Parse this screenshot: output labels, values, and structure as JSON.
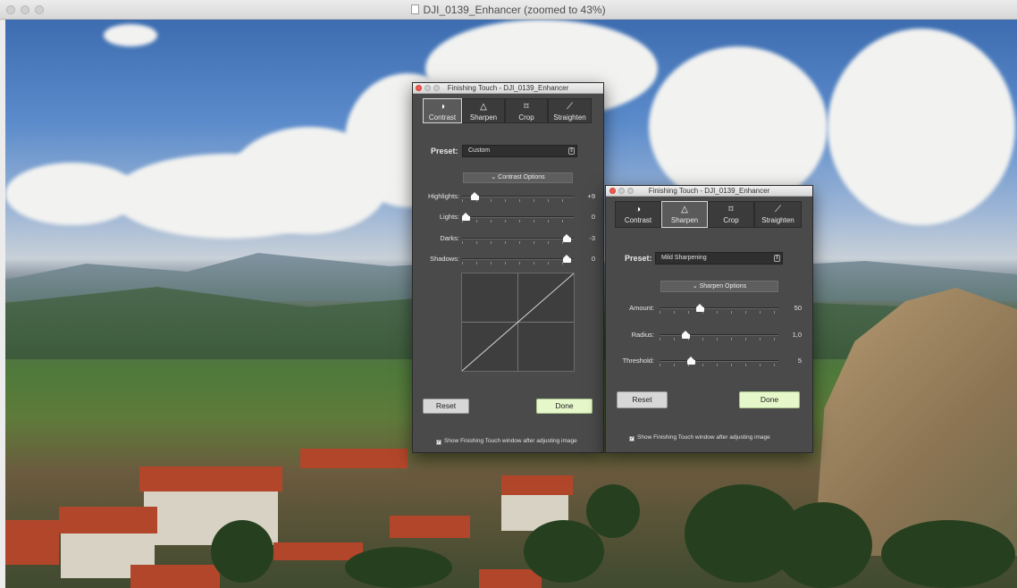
{
  "main_window": {
    "title": "DJI_0139_Enhancer (zoomed to 43%)"
  },
  "contrast_panel": {
    "title": "Finishing Touch - DJI_0139_Enhancer",
    "tools": [
      {
        "label": "Contrast",
        "icon": "◑",
        "active": true
      },
      {
        "label": "Sharpen",
        "icon": "△",
        "active": false
      },
      {
        "label": "Crop",
        "icon": "⌑",
        "active": false
      },
      {
        "label": "Straighten",
        "icon": "⟋",
        "active": false
      }
    ],
    "preset_label": "Preset:",
    "preset_value": "Custom",
    "options_label": "⌄  Contrast Options",
    "sliders": [
      {
        "label": "Highlights:",
        "value": "+9",
        "position": 0.09
      },
      {
        "label": "Lights:",
        "value": "0",
        "position": 0.0
      },
      {
        "label": "Darks:",
        "value": "-3",
        "position": 0.97
      },
      {
        "label": "Shadows:",
        "value": "0",
        "position": 0.97
      }
    ],
    "reset_label": "Reset",
    "done_label": "Done",
    "checkbox_checked": true,
    "checkbox_label": "Show Finishing Touch window after adjusting image"
  },
  "sharpen_panel": {
    "title": "Finishing Touch - DJI_0139_Enhancer",
    "tools": [
      {
        "label": "Contrast",
        "icon": "◑",
        "active": false
      },
      {
        "label": "Sharpen",
        "icon": "△",
        "active": true
      },
      {
        "label": "Crop",
        "icon": "⌑",
        "active": false
      },
      {
        "label": "Straighten",
        "icon": "⟋",
        "active": false
      }
    ],
    "preset_label": "Preset:",
    "preset_value": "Mild Sharpening",
    "options_label": "⌄  Sharpen Options",
    "sliders": [
      {
        "label": "Amount:",
        "value": "50",
        "position": 0.33
      },
      {
        "label": "Radius:",
        "value": "1,0",
        "position": 0.2
      },
      {
        "label": "Threshold:",
        "value": "5",
        "position": 0.25
      }
    ],
    "reset_label": "Reset",
    "done_label": "Done",
    "checkbox_checked": true,
    "checkbox_label": "Show Finishing Touch window after adjusting image"
  }
}
